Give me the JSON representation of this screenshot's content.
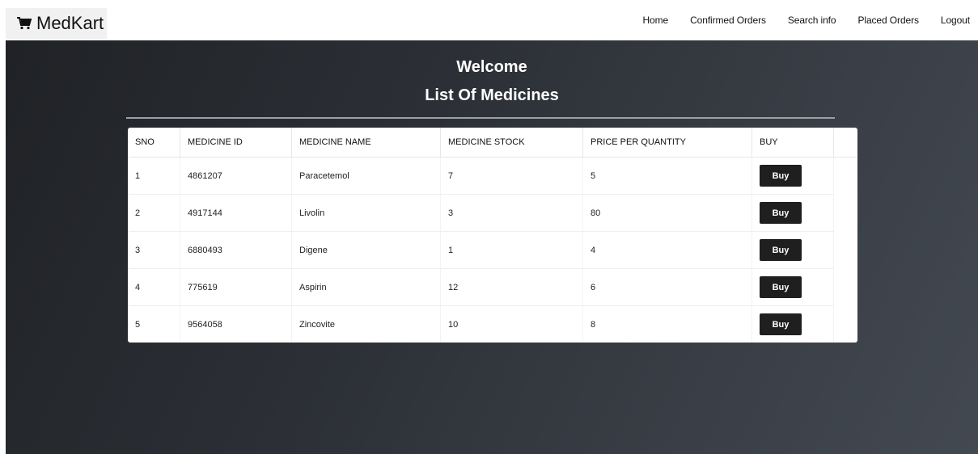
{
  "brand": {
    "name": "MedKart",
    "icon": "cart-icon"
  },
  "nav": {
    "items": [
      {
        "label": "Home"
      },
      {
        "label": "Confirmed Orders"
      },
      {
        "label": "Search info"
      },
      {
        "label": "Placed Orders"
      },
      {
        "label": "Logout"
      }
    ]
  },
  "main": {
    "welcome": "Welcome",
    "title": "List Of Medicines"
  },
  "table": {
    "headers": [
      "SNO",
      "MEDICINE ID",
      "MEDICINE NAME",
      "MEDICINE STOCK",
      "PRICE PER QUANTITY",
      "BUY"
    ],
    "rows": [
      {
        "sno": "1",
        "id": "4861207",
        "name": "Paracetemol",
        "stock": "7",
        "price": "5",
        "buy": "Buy"
      },
      {
        "sno": "2",
        "id": "4917144",
        "name": "Livolin",
        "stock": "3",
        "price": "80",
        "buy": "Buy"
      },
      {
        "sno": "3",
        "id": "6880493",
        "name": "Digene",
        "stock": "1",
        "price": "4",
        "buy": "Buy"
      },
      {
        "sno": "4",
        "id": "775619",
        "name": "Aspirin",
        "stock": "12",
        "price": "6",
        "buy": "Buy"
      },
      {
        "sno": "5",
        "id": "9564058",
        "name": "Zincovite",
        "stock": "10",
        "price": "8",
        "buy": "Buy"
      }
    ]
  },
  "colors": {
    "button": "#1f1f1f",
    "hero_dark": "#202226",
    "hero_light": "#434951"
  }
}
